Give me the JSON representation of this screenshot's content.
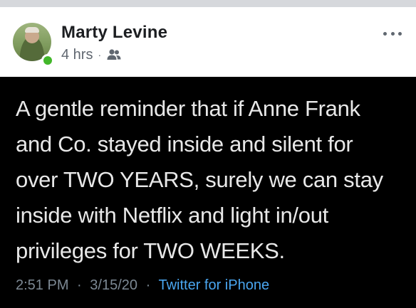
{
  "post": {
    "author_name": "Marty Levine",
    "time_ago": "4 hrs",
    "separator": "·",
    "audience_icon": "friends-icon",
    "online_status_color": "#42b72a",
    "more_icon": "more-options-icon"
  },
  "tweet": {
    "lines": [
      "A gentle reminder that if Anne Frank",
      "and Co. stayed inside and silent for",
      "over TWO YEARS, surely we can stay",
      "inside with Netflix and light in/out",
      "privileges for TWO WEEKS."
    ],
    "time": "2:51 PM",
    "date": "3/15/20",
    "separator": "·",
    "source": "Twitter for iPhone",
    "source_color": "#4aa6f0",
    "background_color": "#000000"
  }
}
